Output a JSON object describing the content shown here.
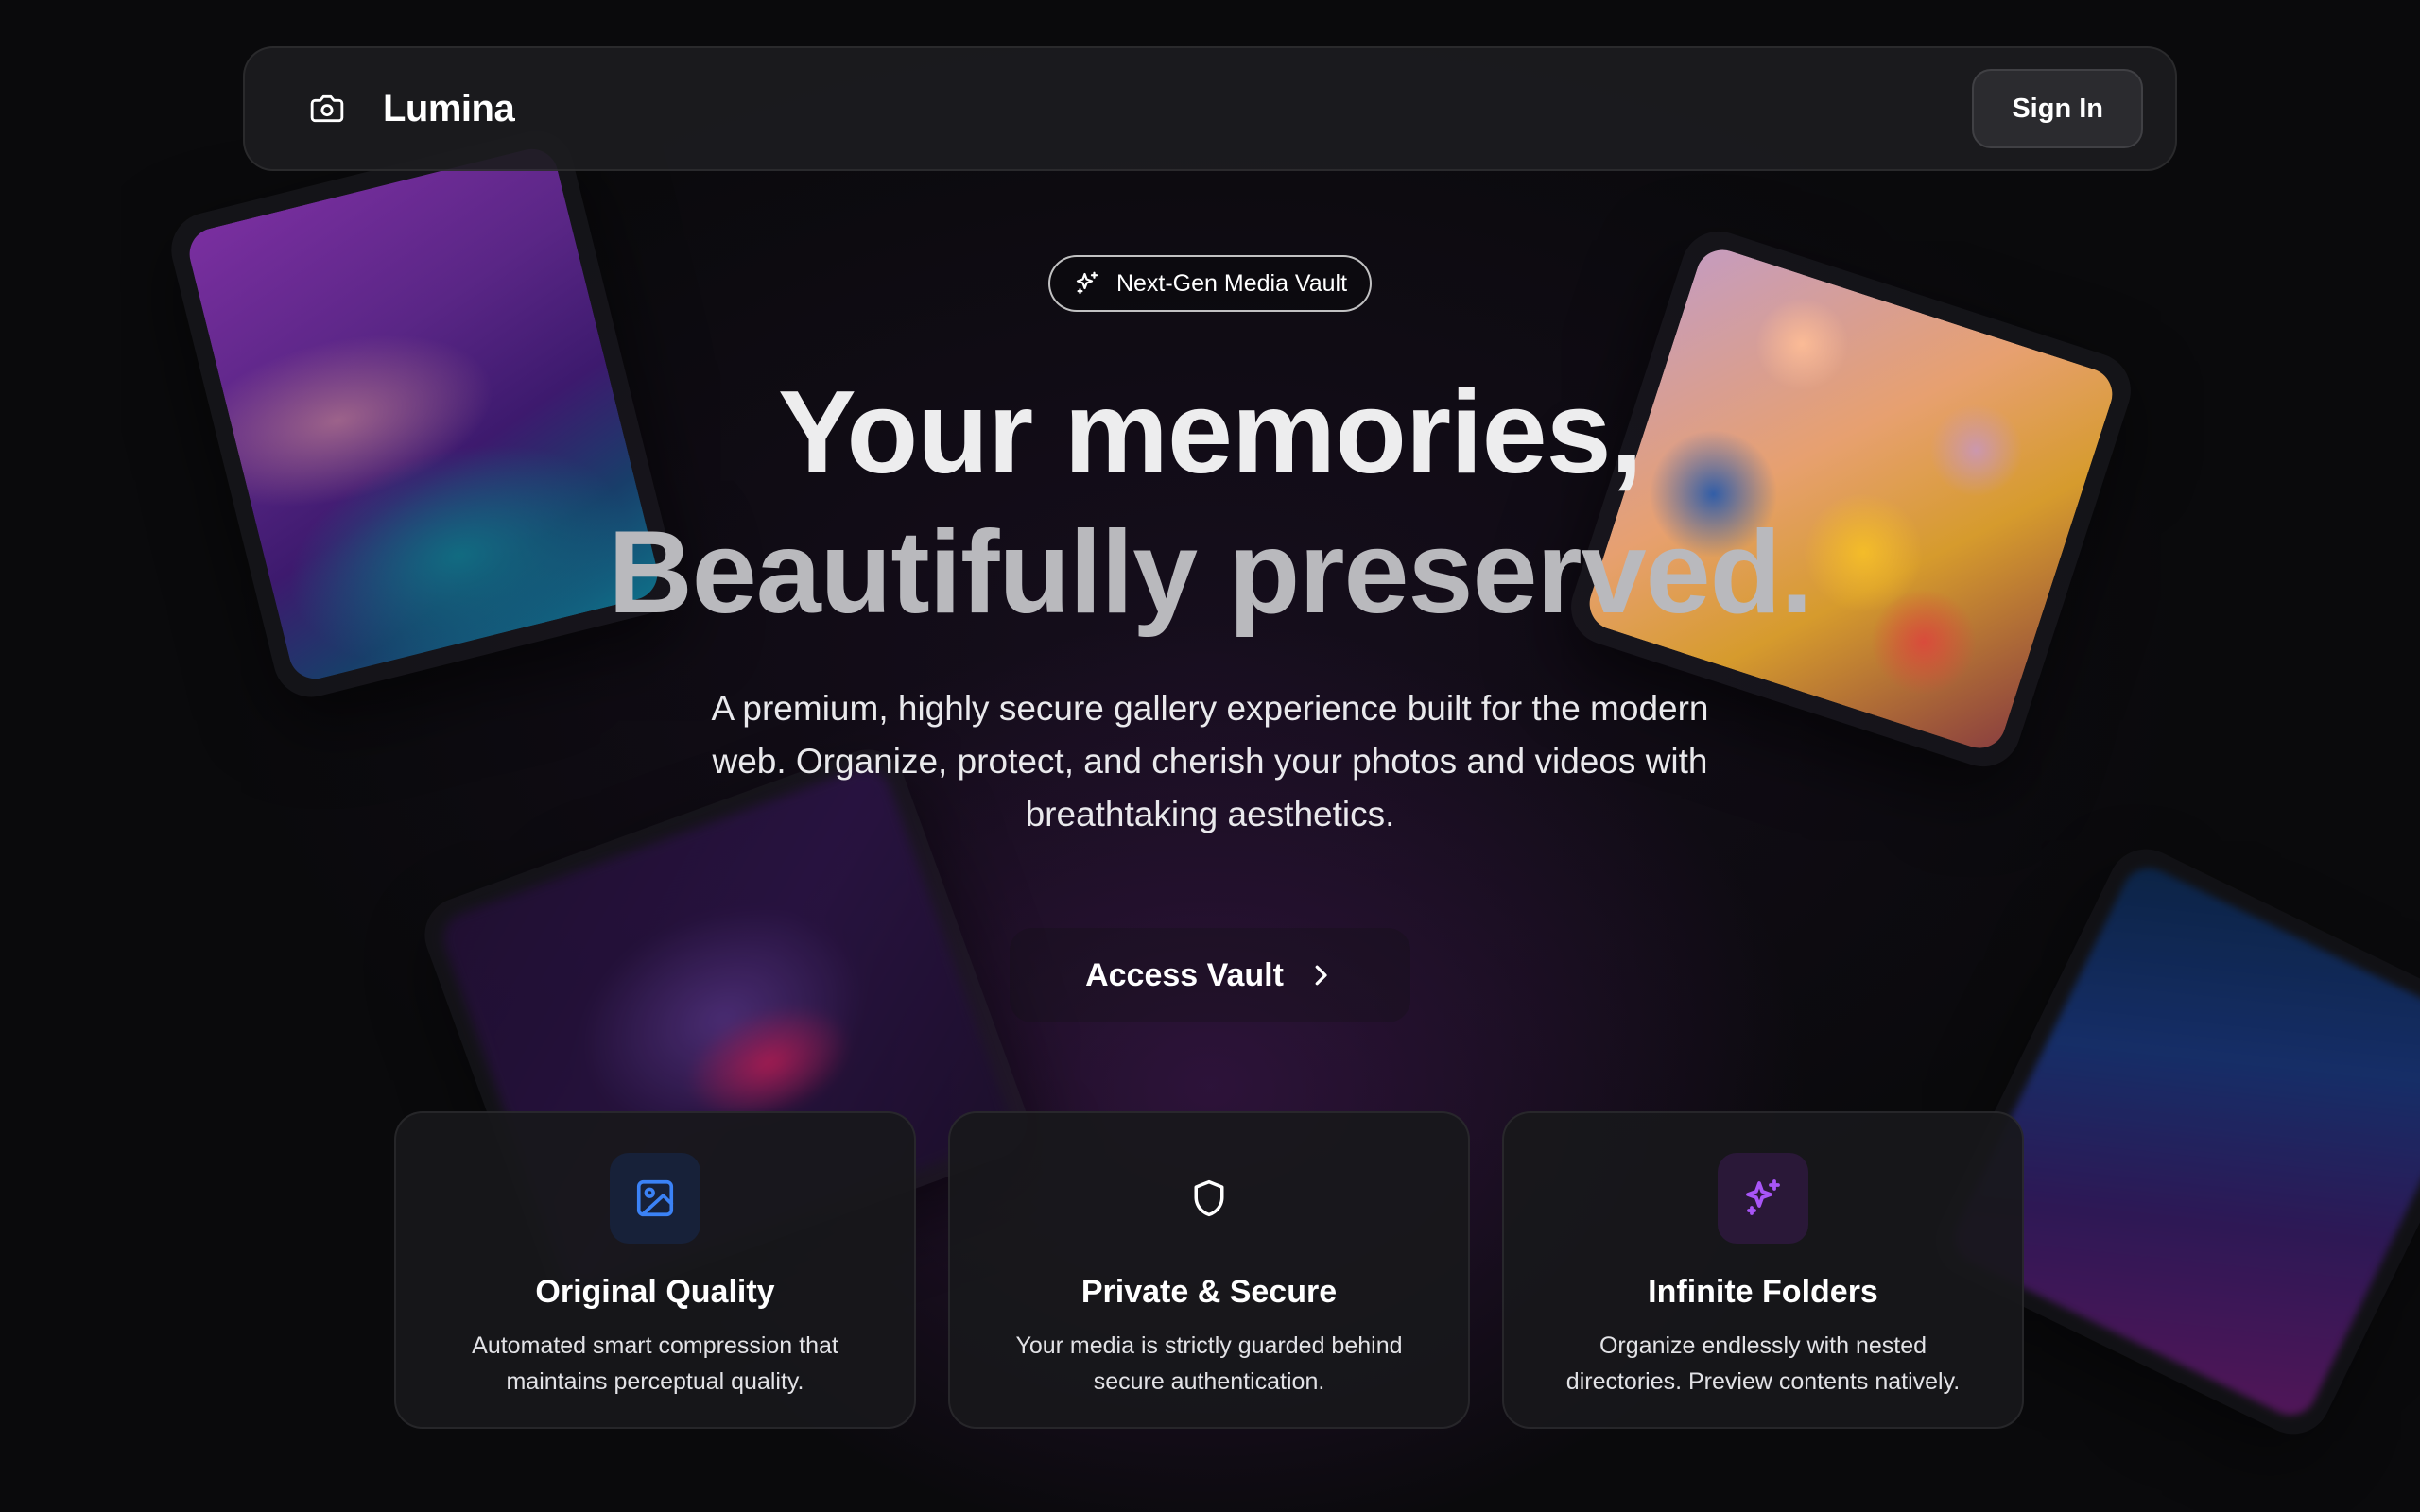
{
  "navbar": {
    "brand_name": "Lumina",
    "brand_icon": "camera-icon",
    "sign_in_label": "Sign In"
  },
  "hero": {
    "badge_icon": "sparkles-icon",
    "badge_label": "Next-Gen Media Vault",
    "headline_line1": "Your memories,",
    "headline_line2": "Beautifully preserved.",
    "subtitle": "A premium, highly secure gallery experience built for the modern web. Organize, protect, and cherish your photos and videos with breathtaking aesthetics.",
    "cta_label": "Access Vault",
    "cta_icon": "chevron-right-icon"
  },
  "features": [
    {
      "icon": "image-icon",
      "accent": "#3b82f6",
      "title": "Original Quality",
      "description": "Automated smart compression that maintains perceptual quality."
    },
    {
      "icon": "shield-icon",
      "accent": "#ffffff",
      "title": "Private & Secure",
      "description": "Your media is strictly guarded behind secure authentication."
    },
    {
      "icon": "sparkles-icon",
      "accent": "#a855f7",
      "title": "Infinite Folders",
      "description": "Organize endlessly with nested directories. Preview contents natively."
    }
  ],
  "colors": {
    "background": "#0a0a0c",
    "card_background": "#18181b",
    "accent_blue": "#3b82f6",
    "accent_purple": "#a855f7"
  }
}
